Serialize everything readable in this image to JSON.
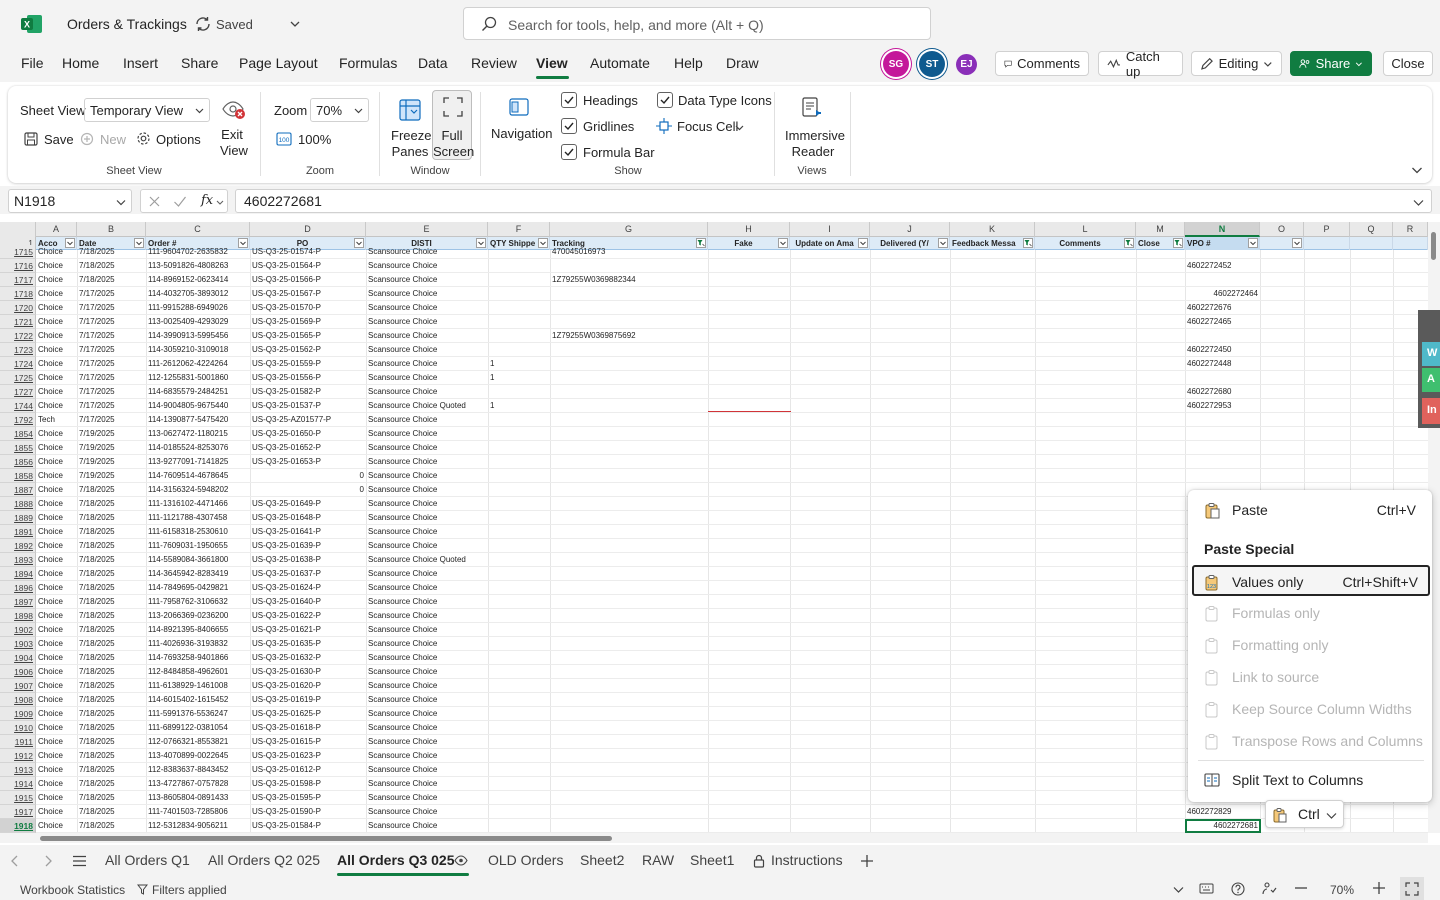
{
  "app": {
    "title": "Orders & Trackings",
    "saved": "Saved"
  },
  "search": {
    "placeholder": "Search for tools, help, and more (Alt + Q)"
  },
  "menu": {
    "items": [
      "File",
      "Home",
      "Insert",
      "Share",
      "Page Layout",
      "Formulas",
      "Data",
      "Review",
      "View",
      "Automate",
      "Help",
      "Draw"
    ],
    "active": "View"
  },
  "avatars": [
    {
      "initials": "SG",
      "color": "#c4189a"
    },
    {
      "initials": "ST",
      "color": "#0f5a8f"
    },
    {
      "initials": "EJ",
      "color": "#8a2fb8"
    }
  ],
  "top_buttons": {
    "comments": "Comments",
    "catch_up": "Catch up",
    "editing": "Editing",
    "share": "Share",
    "close": "Close"
  },
  "ribbon": {
    "sheet_view_label": "Sheet View",
    "sheet_view_value": "Temporary View",
    "save": "Save",
    "new": "New",
    "options": "Options",
    "exit_view": [
      "Exit",
      "View"
    ],
    "group_sheet_view": "Sheet View",
    "zoom_label": "Zoom",
    "zoom_value": "70%",
    "zoom_100": "100%",
    "group_zoom": "Zoom",
    "freeze_panes": [
      "Freeze",
      "Panes"
    ],
    "full_screen": [
      "Full",
      "Screen"
    ],
    "group_window": "Window",
    "navigation": "Navigation",
    "headings": "Headings",
    "gridlines": "Gridlines",
    "formula_bar": "Formula Bar",
    "data_type_icons": "Data Type Icons",
    "focus_cell": "Focus Cell",
    "group_show": "Show",
    "immersive_reader": [
      "Immersive",
      "Reader"
    ],
    "group_views": "Views"
  },
  "formula_bar": {
    "name_box": "N1918",
    "fx": "fx",
    "value": "4602272681"
  },
  "columns": [
    {
      "letter": "A",
      "header": "Acco"
    },
    {
      "letter": "B",
      "header": "Date"
    },
    {
      "letter": "C",
      "header": "Order #"
    },
    {
      "letter": "D",
      "header": "PO"
    },
    {
      "letter": "E",
      "header": "DISTI"
    },
    {
      "letter": "F",
      "header": "QTY Shippe"
    },
    {
      "letter": "G",
      "header": "Tracking"
    },
    {
      "letter": "H",
      "header": "Fake"
    },
    {
      "letter": "I",
      "header": "Update on Ama"
    },
    {
      "letter": "J",
      "header": "Delivered (Y/"
    },
    {
      "letter": "K",
      "header": "Feedback Messa"
    },
    {
      "letter": "L",
      "header": "Comments"
    },
    {
      "letter": "M",
      "header": "Close"
    },
    {
      "letter": "N",
      "header": "VPO #"
    },
    {
      "letter": "O",
      "header": ""
    },
    {
      "letter": "P",
      "header": ""
    },
    {
      "letter": "Q",
      "header": ""
    },
    {
      "letter": "R",
      "header": ""
    }
  ],
  "rows": [
    {
      "num": "1715",
      "a": "Choice",
      "b": "7/18/2025",
      "c": "111-9604702-2635832",
      "d": "US-Q3-25-01574-P",
      "e": "Scansource Choice",
      "f": "",
      "g": "470045016973",
      "n": ""
    },
    {
      "num": "1716",
      "a": "Choice",
      "b": "7/18/2025",
      "c": "113-5091826-4808263",
      "d": "US-Q3-25-01564-P",
      "e": "Scansource Choice",
      "f": "",
      "g": "",
      "n": "4602272452"
    },
    {
      "num": "1717",
      "a": "Choice",
      "b": "7/18/2025",
      "c": "114-8969152-0623414",
      "d": "US-Q3-25-01566-P",
      "e": "Scansource Choice",
      "f": "",
      "g": "1Z79255W0369882344",
      "n": ""
    },
    {
      "num": "1718",
      "a": "Choice",
      "b": "7/17/2025",
      "c": "114-4032705-3893012",
      "d": "US-Q3-25-01567-P",
      "e": "Scansource Choice",
      "f": "",
      "g": "",
      "n": "4602272464"
    },
    {
      "num": "1720",
      "a": "Choice",
      "b": "7/17/2025",
      "c": "111-9915288-6949026",
      "d": "US-Q3-25-01570-P",
      "e": "Scansource Choice",
      "f": "",
      "g": "",
      "n": "4602272676"
    },
    {
      "num": "1721",
      "a": "Choice",
      "b": "7/17/2025",
      "c": "113-0025409-4293029",
      "d": "US-Q3-25-01569-P",
      "e": "Scansource Choice",
      "f": "",
      "g": "",
      "n": "4602272465"
    },
    {
      "num": "1722",
      "a": "Choice",
      "b": "7/17/2025",
      "c": "114-3990913-5995456",
      "d": "US-Q3-25-01565-P",
      "e": "Scansource Choice",
      "f": "",
      "g": "1Z79255W0369875692",
      "n": ""
    },
    {
      "num": "1723",
      "a": "Choice",
      "b": "7/17/2025",
      "c": "114-3059210-3109018",
      "d": "US-Q3-25-01562-P",
      "e": "Scansource Choice",
      "f": "",
      "g": "",
      "n": "4602272450"
    },
    {
      "num": "1724",
      "a": "Choice",
      "b": "7/17/2025",
      "c": "111-2612062-4224264",
      "d": "US-Q3-25-01559-P",
      "e": "Scansource Choice",
      "f": "1",
      "g": "",
      "n": "4602272448"
    },
    {
      "num": "1725",
      "a": "Choice",
      "b": "7/17/2025",
      "c": "112-1255831-5001860",
      "d": "US-Q3-25-01556-P",
      "e": "Scansource Choice",
      "f": "1",
      "g": "",
      "n": ""
    },
    {
      "num": "1727",
      "a": "Choice",
      "b": "7/17/2025",
      "c": "114-6835579-2484251",
      "d": "US-Q3-25-01582-P",
      "e": "Scansource Choice",
      "f": "",
      "g": "",
      "n": "4602272680"
    },
    {
      "num": "1744",
      "a": "Choice",
      "b": "7/17/2025",
      "c": "114-9004805-9675440",
      "d": "US-Q3-25-01537-P",
      "e": "Scansource Choice Quoted",
      "f": "1",
      "g": "",
      "n": "4602272953"
    },
    {
      "num": "1792",
      "a": "Tech",
      "b": "7/17/2025",
      "c": "114-1390877-5475420",
      "d": "US-Q3-25-AZ01577-P",
      "e": "Scansource Choice",
      "f": "",
      "g": "",
      "n": ""
    },
    {
      "num": "1854",
      "a": "Choice",
      "b": "7/19/2025",
      "c": "113-0627472-1180215",
      "d": "US-Q3-25-01650-P",
      "e": "Scansource Choice",
      "f": "",
      "g": "",
      "n": ""
    },
    {
      "num": "1855",
      "a": "Choice",
      "b": "7/19/2025",
      "c": "114-0185524-8253076",
      "d": "US-Q3-25-01652-P",
      "e": "Scansource Choice",
      "f": "",
      "g": "",
      "n": ""
    },
    {
      "num": "1856",
      "a": "Choice",
      "b": "7/19/2025",
      "c": "113-9277091-7141825",
      "d": "US-Q3-25-01653-P",
      "e": "Scansource Choice",
      "f": "",
      "g": "",
      "n": ""
    },
    {
      "num": "1858",
      "a": "Choice",
      "b": "7/19/2025",
      "c": "114-7609514-4678645",
      "d": "0",
      "e": "Scansource Choice",
      "f": "",
      "g": "",
      "n": ""
    },
    {
      "num": "1887",
      "a": "Choice",
      "b": "7/18/2025",
      "c": "114-3156324-5948202",
      "d": "0",
      "e": "Scansource Choice",
      "f": "",
      "g": "",
      "n": ""
    },
    {
      "num": "1888",
      "a": "Choice",
      "b": "7/18/2025",
      "c": "111-1316102-4471466",
      "d": "US-Q3-25-01649-P",
      "e": "Scansource Choice",
      "f": "",
      "g": "",
      "n": ""
    },
    {
      "num": "1889",
      "a": "Choice",
      "b": "7/18/2025",
      "c": "111-1121788-4307458",
      "d": "US-Q3-25-01648-P",
      "e": "Scansource Choice",
      "f": "",
      "g": "",
      "n": ""
    },
    {
      "num": "1891",
      "a": "Choice",
      "b": "7/18/2025",
      "c": "111-6158318-2530610",
      "d": "US-Q3-25-01641-P",
      "e": "Scansource Choice",
      "f": "",
      "g": "",
      "n": ""
    },
    {
      "num": "1892",
      "a": "Choice",
      "b": "7/18/2025",
      "c": "111-7609031-1950655",
      "d": "US-Q3-25-01639-P",
      "e": "Scansource Choice",
      "f": "",
      "g": "",
      "n": ""
    },
    {
      "num": "1893",
      "a": "Choice",
      "b": "7/18/2025",
      "c": "114-5589084-3661800",
      "d": "US-Q3-25-01638-P",
      "e": "Scansource Choice Quoted",
      "f": "",
      "g": "",
      "n": ""
    },
    {
      "num": "1894",
      "a": "Choice",
      "b": "7/18/2025",
      "c": "114-3645942-8283419",
      "d": "US-Q3-25-01637-P",
      "e": "Scansource Choice",
      "f": "",
      "g": "",
      "n": ""
    },
    {
      "num": "1896",
      "a": "Choice",
      "b": "7/18/2025",
      "c": "114-7849695-0429821",
      "d": "US-Q3-25-01624-P",
      "e": "Scansource Choice",
      "f": "",
      "g": "",
      "n": ""
    },
    {
      "num": "1897",
      "a": "Choice",
      "b": "7/18/2025",
      "c": "111-7958762-3106632",
      "d": "US-Q3-25-01640-P",
      "e": "Scansource Choice",
      "f": "",
      "g": "",
      "n": ""
    },
    {
      "num": "1898",
      "a": "Choice",
      "b": "7/18/2025",
      "c": "113-2066369-0236200",
      "d": "US-Q3-25-01622-P",
      "e": "Scansource Choice",
      "f": "",
      "g": "",
      "n": ""
    },
    {
      "num": "1902",
      "a": "Choice",
      "b": "7/18/2025",
      "c": "114-8921395-8406655",
      "d": "US-Q3-25-01621-P",
      "e": "Scansource Choice",
      "f": "",
      "g": "",
      "n": ""
    },
    {
      "num": "1903",
      "a": "Choice",
      "b": "7/18/2025",
      "c": "111-4026936-3193832",
      "d": "US-Q3-25-01635-P",
      "e": "Scansource Choice",
      "f": "",
      "g": "",
      "n": ""
    },
    {
      "num": "1904",
      "a": "Choice",
      "b": "7/18/2025",
      "c": "114-7693258-9401866",
      "d": "US-Q3-25-01632-P",
      "e": "Scansource Choice",
      "f": "",
      "g": "",
      "n": ""
    },
    {
      "num": "1906",
      "a": "Choice",
      "b": "7/18/2025",
      "c": "112-8484858-4962601",
      "d": "US-Q3-25-01630-P",
      "e": "Scansource Choice",
      "f": "",
      "g": "",
      "n": ""
    },
    {
      "num": "1907",
      "a": "Choice",
      "b": "7/18/2025",
      "c": "111-6138929-1461008",
      "d": "US-Q3-25-01620-P",
      "e": "Scansource Choice",
      "f": "",
      "g": "",
      "n": ""
    },
    {
      "num": "1908",
      "a": "Choice",
      "b": "7/18/2025",
      "c": "114-6015402-1615452",
      "d": "US-Q3-25-01619-P",
      "e": "Scansource Choice",
      "f": "",
      "g": "",
      "n": ""
    },
    {
      "num": "1909",
      "a": "Choice",
      "b": "7/18/2025",
      "c": "111-5991376-5536247",
      "d": "US-Q3-25-01625-P",
      "e": "Scansource Choice",
      "f": "",
      "g": "",
      "n": ""
    },
    {
      "num": "1910",
      "a": "Choice",
      "b": "7/18/2025",
      "c": "111-6899122-0381054",
      "d": "US-Q3-25-01618-P",
      "e": "Scansource Choice",
      "f": "",
      "g": "",
      "n": ""
    },
    {
      "num": "1911",
      "a": "Choice",
      "b": "7/18/2025",
      "c": "112-0766321-8553821",
      "d": "US-Q3-25-01615-P",
      "e": "Scansource Choice",
      "f": "",
      "g": "",
      "n": ""
    },
    {
      "num": "1912",
      "a": "Choice",
      "b": "7/18/2025",
      "c": "113-4070899-0022645",
      "d": "US-Q3-25-01623-P",
      "e": "Scansource Choice",
      "f": "",
      "g": "",
      "n": ""
    },
    {
      "num": "1913",
      "a": "Choice",
      "b": "7/18/2025",
      "c": "112-8383637-8843452",
      "d": "US-Q3-25-01612-P",
      "e": "Scansource Choice",
      "f": "",
      "g": "",
      "n": ""
    },
    {
      "num": "1914",
      "a": "Choice",
      "b": "7/18/2025",
      "c": "113-4727867-0757828",
      "d": "US-Q3-25-01598-P",
      "e": "Scansource Choice",
      "f": "",
      "g": "",
      "n": ""
    },
    {
      "num": "1915",
      "a": "Choice",
      "b": "7/18/2025",
      "c": "113-8605804-0891433",
      "d": "US-Q3-25-01595-P",
      "e": "Scansource Choice",
      "f": "",
      "g": "",
      "n": ""
    },
    {
      "num": "1917",
      "a": "Choice",
      "b": "7/18/2025",
      "c": "111-7401503-7285806",
      "d": "US-Q3-25-01590-P",
      "e": "Scansource Choice",
      "f": "",
      "g": "",
      "n": "4602272829"
    },
    {
      "num": "1918",
      "a": "Choice",
      "b": "7/18/2025",
      "c": "112-5312834-9056211",
      "d": "US-Q3-25-01584-P",
      "e": "Scansource Choice",
      "f": "",
      "g": "",
      "n": "4602272681"
    }
  ],
  "context_menu": {
    "paste": "Paste",
    "paste_shortcut": "Ctrl+V",
    "paste_special": "Paste Special",
    "values_only": "Values only",
    "values_only_shortcut": "Ctrl+Shift+V",
    "formulas_only": "Formulas only",
    "formatting_only": "Formatting only",
    "link_to_source": "Link to source",
    "keep_widths": "Keep Source Column Widths",
    "transpose": "Transpose Rows and Columns",
    "split_text": "Split Text to Columns"
  },
  "paste_options": {
    "label": "Ctrl"
  },
  "sheet_tabs": [
    "All Orders Q1",
    "All Orders Q2 025",
    "All Orders Q3 025",
    "OLD Orders",
    "Sheet2",
    "RAW",
    "Sheet1",
    "Instructions"
  ],
  "active_tab": "All Orders Q3 025",
  "status": {
    "workbook_stats": "Workbook Statistics",
    "filters": "Filters applied",
    "zoom": "70%"
  },
  "side_panel": [
    "W",
    "A",
    "In"
  ]
}
